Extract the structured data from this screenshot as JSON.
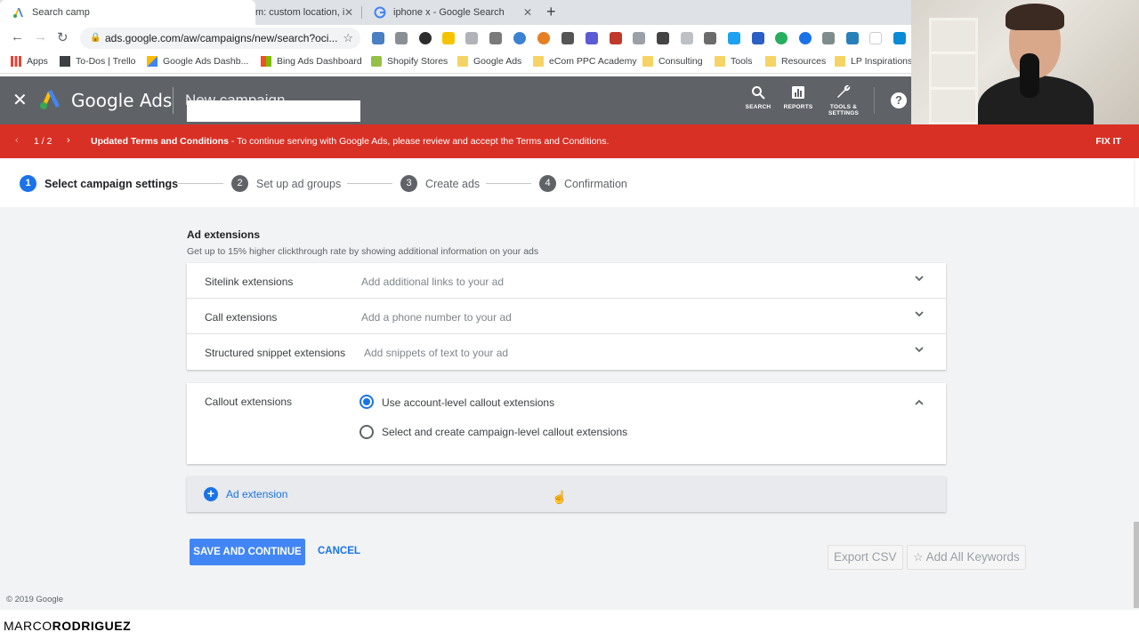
{
  "browser": {
    "tabs": [
      {
        "title": "Search camp",
        "active": true
      },
      {
        "title": "m: custom location, i",
        "active": false
      },
      {
        "title": "iphone x - Google Search",
        "active": false
      }
    ],
    "url": "ads.google.com/aw/campaigns/new/search?oci...",
    "bookmarks": [
      "Apps",
      "To-Dos | Trello",
      "Google Ads Dashb...",
      "Bing Ads Dashboard",
      "Shopify Stores",
      "Google Ads",
      "eCom PPC Academy",
      "Consulting",
      "Tools",
      "Resources",
      "LP Inspirations"
    ]
  },
  "header": {
    "brand": "Google Ads",
    "page_title": "New campaign",
    "actions": [
      {
        "label": "SEARCH",
        "icon": "search-icon"
      },
      {
        "label": "REPORTS",
        "icon": "reports-icon"
      },
      {
        "label": "TOOLS &",
        "label2": "SETTINGS",
        "icon": "wrench-icon"
      }
    ],
    "help": "?"
  },
  "notice": {
    "count": "1 / 2",
    "title": "Updated Terms and Conditions",
    "message": " - To continue serving with Google Ads, please review and accept the Terms and Conditions.",
    "action": "FIX IT",
    "color": "#d93025"
  },
  "stepper": [
    {
      "num": "1",
      "label": "Select campaign settings",
      "active": true
    },
    {
      "num": "2",
      "label": "Set up ad groups",
      "active": false
    },
    {
      "num": "3",
      "label": "Create ads",
      "active": false
    },
    {
      "num": "4",
      "label": "Confirmation",
      "active": false
    }
  ],
  "extensions": {
    "title": "Ad extensions",
    "subtitle": "Get up to 15% higher clickthrough rate by showing additional information on your ads",
    "rows": [
      {
        "name": "Sitelink extensions",
        "desc": "Add additional links to your ad"
      },
      {
        "name": "Call extensions",
        "desc": "Add a phone number to your ad"
      },
      {
        "name": "Structured snippet extensions",
        "desc": "Add snippets of text to your ad"
      }
    ],
    "callout": {
      "name": "Callout extensions",
      "options": [
        {
          "label": "Use account-level callout extensions",
          "selected": true
        },
        {
          "label": "Select and create campaign-level callout extensions",
          "selected": false
        }
      ]
    },
    "add_label": "Ad extension"
  },
  "actions": {
    "save": "SAVE AND CONTINUE",
    "cancel": "CANCEL",
    "export": "Export CSV",
    "add_keywords": "Add All Keywords"
  },
  "footer": {
    "copyright": "© 2019 Google",
    "watermark_first": "MARCO",
    "watermark_last": "RODRIGUEZ"
  },
  "colors": {
    "accent": "#1a73e8",
    "header_bg": "#5f6368",
    "save_bg": "#4285f4"
  }
}
